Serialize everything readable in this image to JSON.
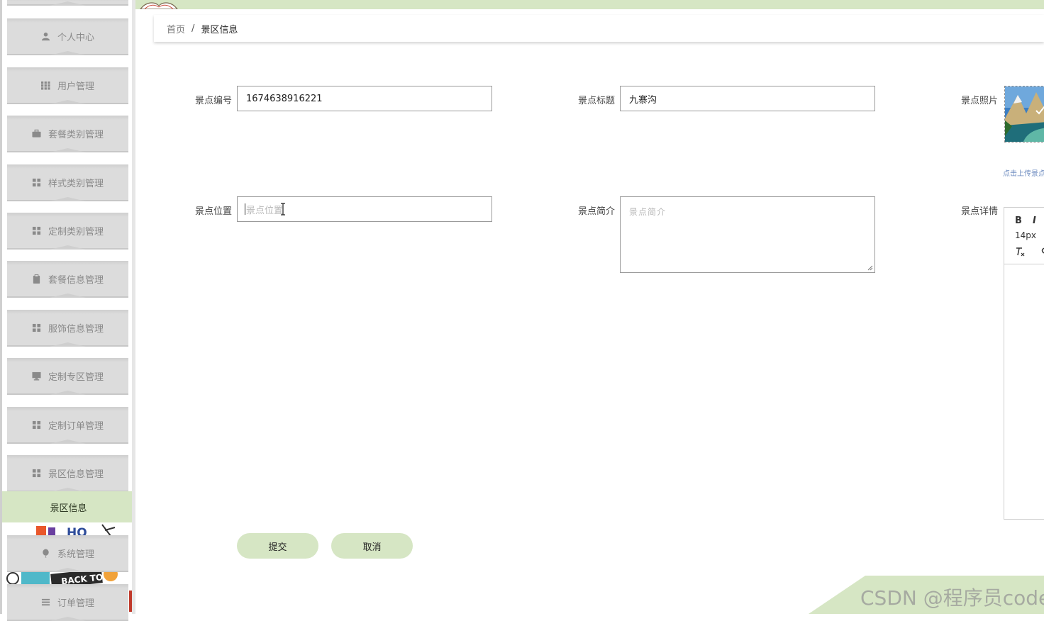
{
  "sidebar": {
    "items": [
      {
        "label": "个人中心",
        "icon": "user-icon"
      },
      {
        "label": "用户管理",
        "icon": "grid-icon"
      },
      {
        "label": "套餐类别管理",
        "icon": "briefcase-icon"
      },
      {
        "label": "样式类别管理",
        "icon": "apps-icon"
      },
      {
        "label": "定制类别管理",
        "icon": "apps-icon"
      },
      {
        "label": "套餐信息管理",
        "icon": "clipboard-icon"
      },
      {
        "label": "服饰信息管理",
        "icon": "apps-icon"
      },
      {
        "label": "定制专区管理",
        "icon": "monitor-icon"
      },
      {
        "label": "定制订单管理",
        "icon": "apps-icon"
      },
      {
        "label": "景区信息管理",
        "icon": "apps-icon"
      }
    ],
    "active_sub": "景区信息",
    "bottom_items": [
      {
        "label": "系统管理",
        "icon": "balloon-icon"
      },
      {
        "label": "订单管理",
        "icon": "list-icon"
      }
    ],
    "deco_text": {
      "top": "HO",
      "bottom": "BACK TO"
    }
  },
  "breadcrumb": {
    "home": "首页",
    "separator": "/",
    "current": "景区信息"
  },
  "form": {
    "number": {
      "label": "景点编号",
      "value": "1674638916221"
    },
    "title": {
      "label": "景点标题",
      "value": "九寨沟"
    },
    "photo": {
      "label": "景点照片",
      "hint": "点击上传景点"
    },
    "location": {
      "label": "景点位置",
      "placeholder": "景点位置"
    },
    "intro": {
      "label": "景点简介",
      "placeholder": "景点简介"
    },
    "detail": {
      "label": "景点详情",
      "bold": "B",
      "italic": "I",
      "font_size": "14px"
    }
  },
  "buttons": {
    "submit": "提交",
    "cancel": "取消"
  },
  "watermark": "CSDN @程序员code",
  "colors": {
    "accent": "#d6e6c4",
    "menu_bg": "#dcdcdc",
    "menu_text": "#8a8a8a"
  }
}
